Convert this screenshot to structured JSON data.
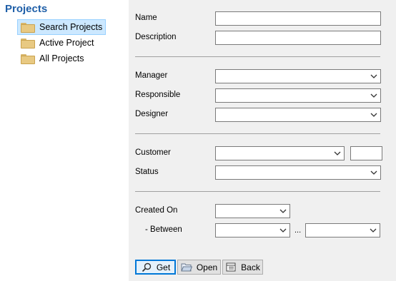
{
  "tree": {
    "title": "Projects",
    "items": [
      {
        "label": "Search Projects",
        "selected": true
      },
      {
        "label": "Active Project",
        "selected": false
      },
      {
        "label": "All Projects",
        "selected": false
      }
    ]
  },
  "form": {
    "name_label": "Name",
    "description_label": "Description",
    "manager_label": "Manager",
    "responsible_label": "Responsible",
    "designer_label": "Designer",
    "customer_label": "Customer",
    "status_label": "Status",
    "created_on_label": "Created On",
    "between_label": "-  Between",
    "range_separator": "..."
  },
  "buttons": {
    "get": "Get",
    "open": "Open",
    "back": "Back"
  },
  "icons": {
    "folder": "folder-icon",
    "get": "magnifier-icon",
    "open": "open-folder-icon",
    "back": "back-list-icon",
    "dropdown": "chevron-down-icon"
  }
}
